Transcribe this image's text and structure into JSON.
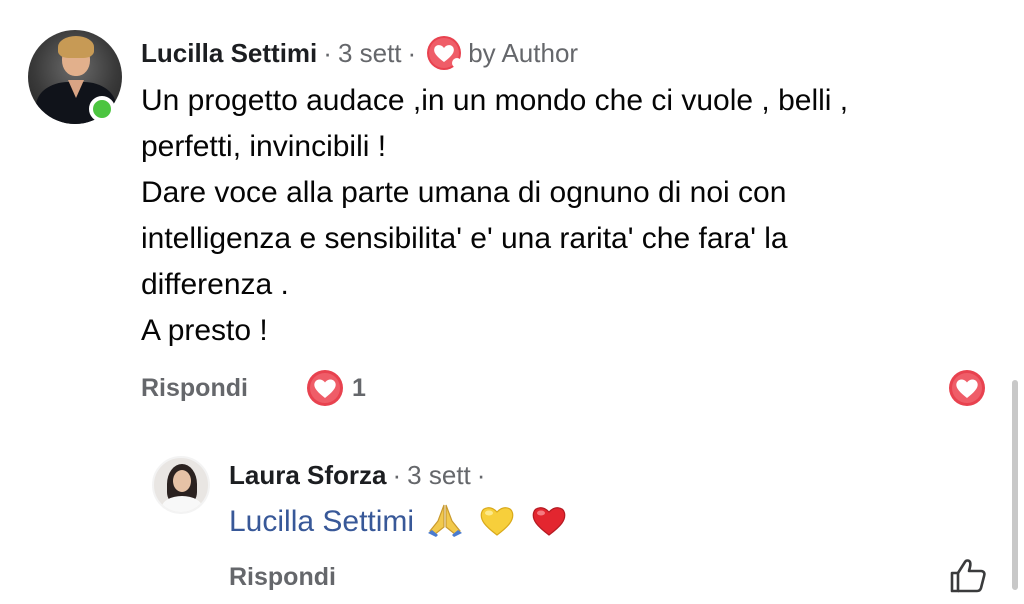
{
  "main_comment": {
    "author": "Lucilla Settimi",
    "separator": "·",
    "time": "3 sett",
    "author_badge": "by Author",
    "body_lines": [
      "Un progetto audace ,in un mondo che ci vuole , belli ,",
      "perfetti, invincibili !",
      "Dare voce alla parte umana di ognuno di noi con",
      "intelligenza e sensibilita' e' una rarita' che fara' la",
      "differenza .",
      "A presto !"
    ],
    "reply_label": "Rispondi",
    "reaction_count": "1",
    "online": true
  },
  "reply": {
    "author": "Laura Sforza",
    "separator": "·",
    "time": "3 sett",
    "mention": "Lucilla Settimi",
    "emojis": [
      "folded-hands",
      "yellow-heart",
      "red-heart"
    ],
    "reply_label": "Rispondi"
  },
  "colors": {
    "heart_red": "#e8424f",
    "online_green": "#4cc540",
    "meta_gray": "#65676b",
    "mention_blue": "#385898"
  },
  "icons": [
    "heart-icon",
    "thumbs-up-icon",
    "online-status-icon"
  ]
}
